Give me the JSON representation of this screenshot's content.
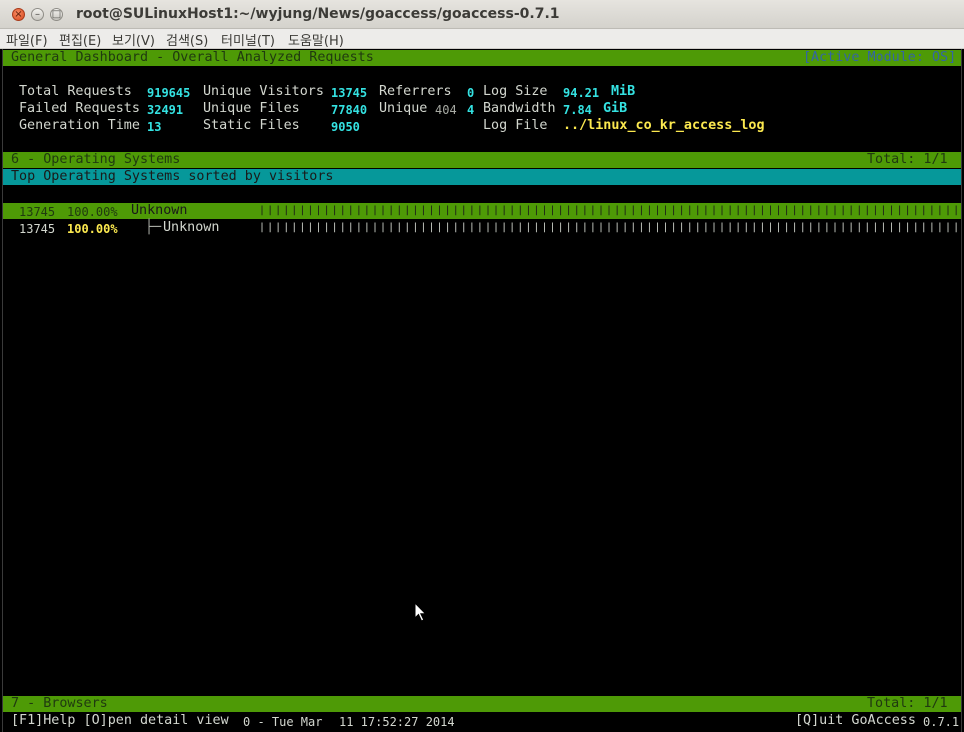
{
  "window": {
    "title": "root@SULinuxHost1:~/wyjung/News/goaccess/goaccess-0.7.1",
    "close_glyph": "×",
    "minimize_glyph": "–",
    "maximize_glyph": "□"
  },
  "menu": {
    "items": [
      "파일(F)",
      "편집(E)",
      "보기(V)",
      "검색(S)",
      "터미널(T)",
      "도움말(H)"
    ]
  },
  "header": {
    "title": "General Dashboard - Overall Analyzed Requests",
    "active_module": "[Active Module: OS]"
  },
  "stats": {
    "total_requests_label": "Total Requests",
    "total_requests_value": "919645",
    "unique_visitors_label": "Unique Visitors",
    "unique_visitors_value": "13745",
    "referrers_label": "Referrers",
    "referrers_value": "0",
    "log_size_label": "Log Size",
    "log_size_value": "94.21",
    "log_size_unit": "MiB",
    "failed_requests_label": "Failed Requests",
    "failed_requests_value": "32491",
    "unique_files_label": "Unique Files",
    "unique_files_value": "77840",
    "unique_404_label": "Unique",
    "unique_404_code": "404",
    "unique_404_value": "4",
    "bandwidth_label": "Bandwidth",
    "bandwidth_value": "7.84",
    "bandwidth_unit": "GiB",
    "generation_time_label": "Generation Time",
    "generation_time_value": "13",
    "static_files_label": "Static Files",
    "static_files_value": "9050",
    "log_file_label": "Log File",
    "log_file_value": "../linux_co_kr_access_log"
  },
  "module_os": {
    "title": "6 - Operating Systems",
    "total": "Total: 1/1",
    "subtitle": "Top Operating Systems sorted by visitors",
    "rows": [
      {
        "hits": "13745",
        "percent": "100.00%",
        "name": "Unknown",
        "tree": ""
      },
      {
        "hits": "13745",
        "percent": "100.00%",
        "name": "Unknown",
        "tree": "├─"
      }
    ],
    "bar_fraction": 1.0
  },
  "module_browsers": {
    "title": "7 - Browsers",
    "total": "Total: 1/1"
  },
  "footer": {
    "help": "[F1]Help [O]pen detail view",
    "date_prefix": "0 - Tue Mar",
    "date_rest": "11 17:52:27 2014",
    "quit": "[Q]uit GoAccess",
    "version": "0.7.1"
  }
}
